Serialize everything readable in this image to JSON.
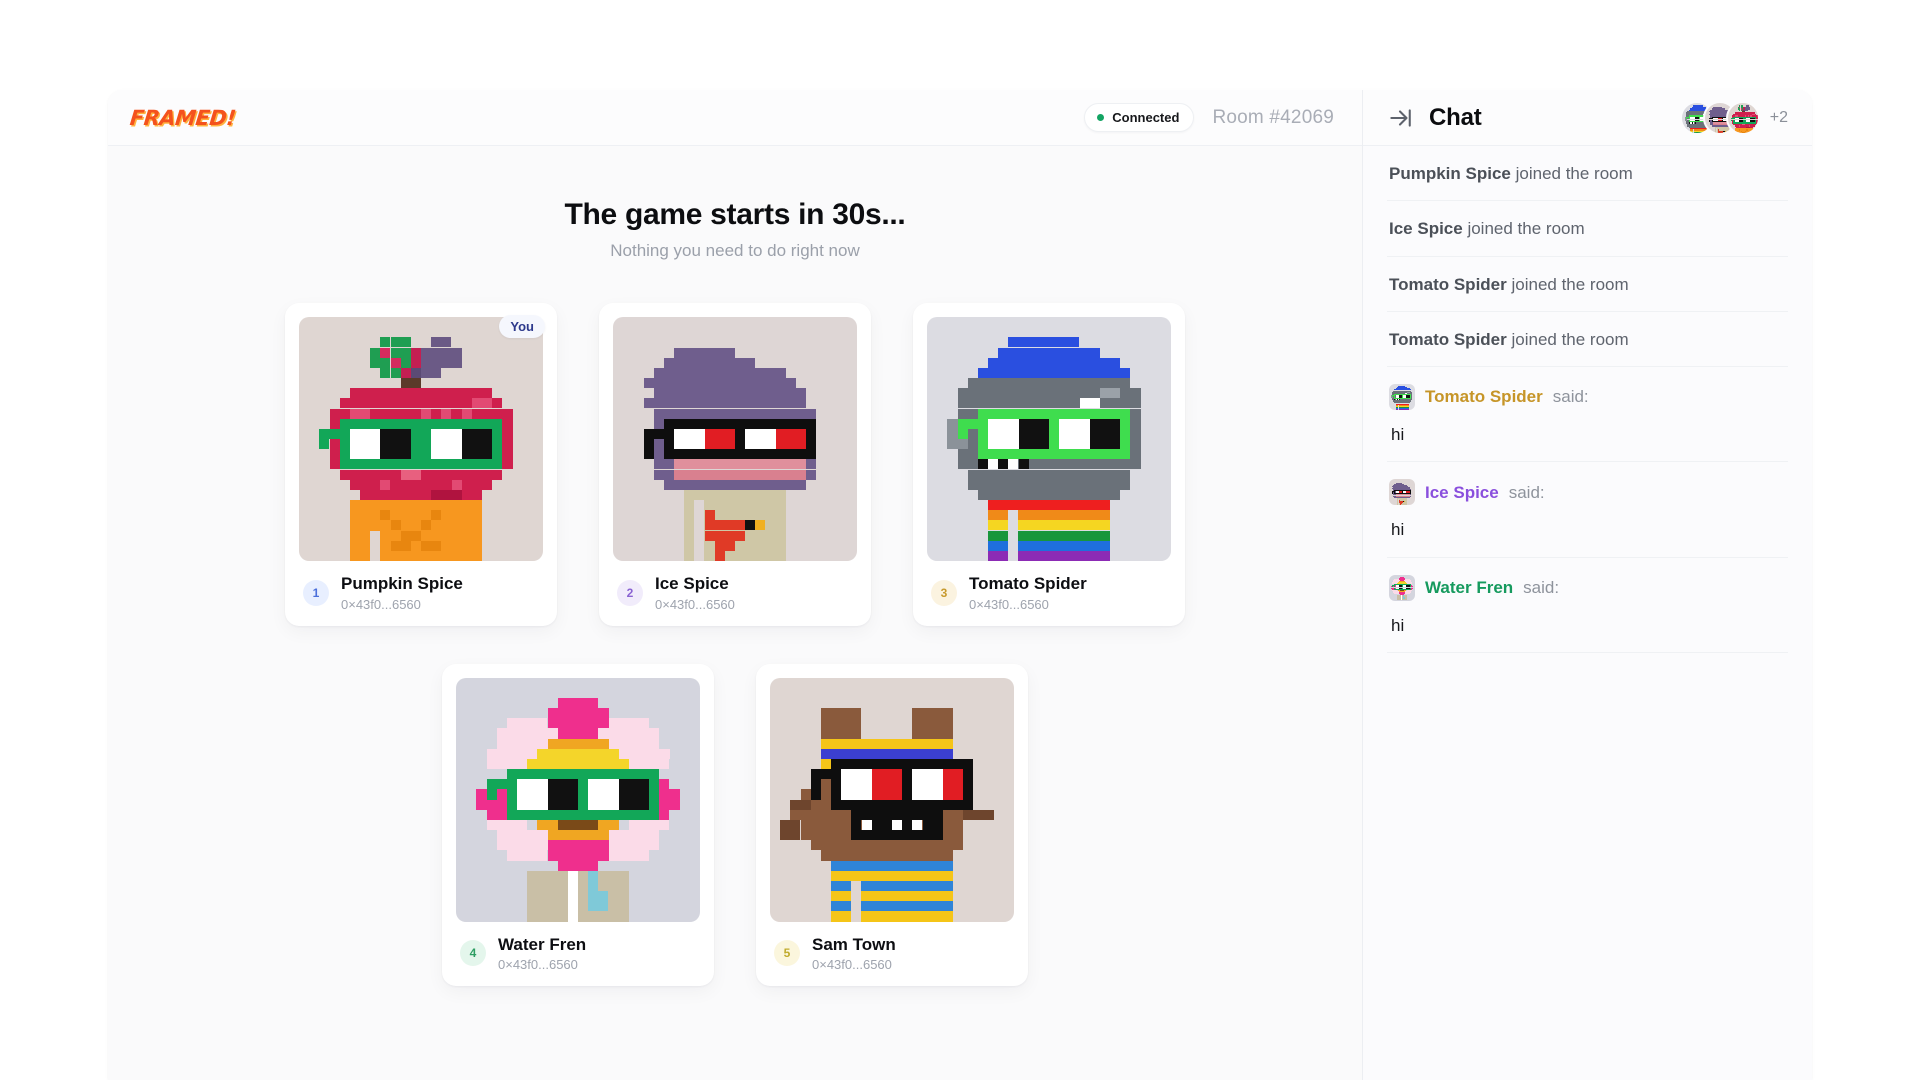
{
  "app": {
    "brand": "FRAMED!",
    "connection": {
      "label": "Connected",
      "status_color": "#13a463"
    },
    "room": "Room #42069"
  },
  "game": {
    "headline": "The game starts in 30s...",
    "subhead": "Nothing you need to do right now",
    "you_badge": "You",
    "players": [
      {
        "rank": "1",
        "name": "Pumpkin Spice",
        "address": "0×43f0...6560",
        "is_you": true,
        "rank_bg": "#e8efff",
        "rank_color": "#4b6fdb",
        "avatar_bg": "#dfd6d2",
        "avatar_id": "pumpkin-spice-avatar"
      },
      {
        "rank": "2",
        "name": "Ice Spice",
        "address": "0×43f0...6560",
        "is_you": false,
        "rank_bg": "#f1ecfb",
        "rank_color": "#8a63d2",
        "avatar_bg": "#ded6d5",
        "avatar_id": "ice-spice-avatar"
      },
      {
        "rank": "3",
        "name": "Tomato Spider",
        "address": "0×43f0...6560",
        "is_you": false,
        "rank_bg": "#fbf3e0",
        "rank_color": "#c79a2e",
        "avatar_bg": "#dcdce2",
        "avatar_id": "tomato-spider-avatar"
      },
      {
        "rank": "4",
        "name": "Water Fren",
        "address": "0×43f0...6560",
        "is_you": false,
        "rank_bg": "#e4f6ec",
        "rank_color": "#2e9e63",
        "avatar_bg": "#d4d5de",
        "avatar_id": "water-fren-avatar"
      },
      {
        "rank": "5",
        "name": "Sam Town",
        "address": "0×43f0...6560",
        "is_you": false,
        "rank_bg": "#fbf6dd",
        "rank_color": "#c0ab2c",
        "avatar_bg": "#dfd6d2",
        "avatar_id": "sam-town-avatar"
      }
    ]
  },
  "chat": {
    "title": "Chat",
    "collapse_icon": "arrow-to-line-right-icon",
    "overflow_count": "+2",
    "header_avatars": [
      "tomato-spider-avatar",
      "ice-spice-avatar",
      "pumpkin-spice-avatar"
    ],
    "messages": [
      {
        "kind": "system",
        "name": "Pumpkin Spice",
        "text": "joined the room"
      },
      {
        "kind": "system",
        "name": "Ice Spice",
        "text": "joined the room"
      },
      {
        "kind": "system",
        "name": "Tomato Spider",
        "text": "joined the room"
      },
      {
        "kind": "system",
        "name": "Tomato Spider",
        "text": "joined the room"
      },
      {
        "kind": "said",
        "name": "Tomato Spider",
        "suffix": "said:",
        "body": "hi",
        "name_color": "#c69528",
        "avatar_id": "tomato-spider-avatar"
      },
      {
        "kind": "said",
        "name": "Ice Spice",
        "suffix": "said:",
        "body": "hi",
        "name_color": "#8a4fdd",
        "avatar_id": "ice-spice-avatar"
      },
      {
        "kind": "said",
        "name": "Water Fren",
        "suffix": "said:",
        "body": "hi",
        "name_color": "#169a5e",
        "avatar_id": "water-fren-avatar"
      }
    ]
  }
}
